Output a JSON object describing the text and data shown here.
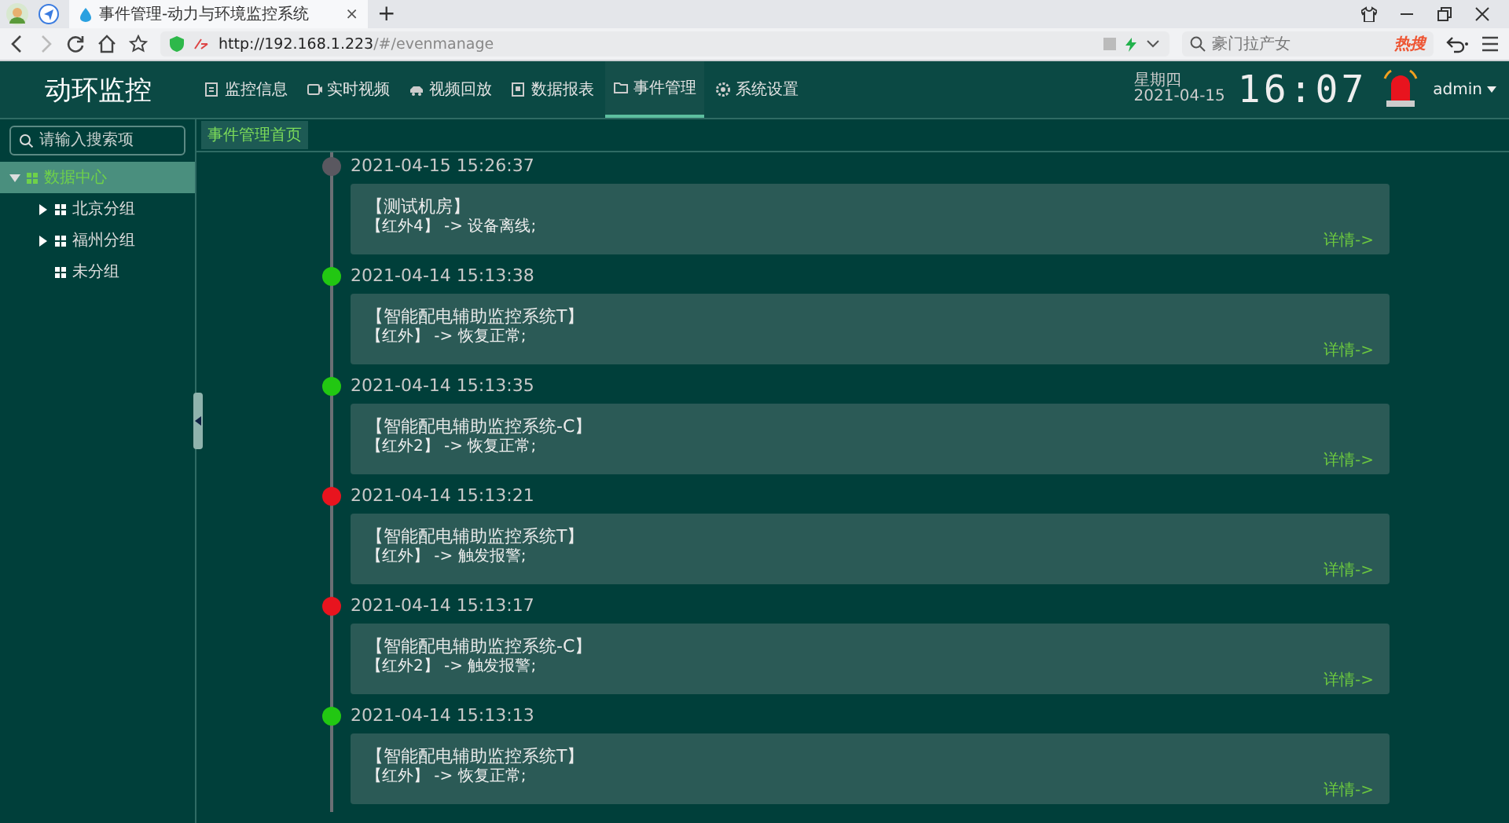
{
  "browser": {
    "tab_title": "事件管理-动力与环境监控系统",
    "tab_close": "×",
    "new_tab": "+",
    "url_host": "http://192.168.1.223",
    "url_path": "/#/evenmanage",
    "search_hint": "豪门拉产女",
    "hot": "热搜"
  },
  "header": {
    "title": "动环监控",
    "nav": [
      {
        "label": "监控信息",
        "selected": false
      },
      {
        "label": "实时视频",
        "selected": false
      },
      {
        "label": "视频回放",
        "selected": false
      },
      {
        "label": "数据报表",
        "selected": false
      },
      {
        "label": "事件管理",
        "selected": true
      },
      {
        "label": "系统设置",
        "selected": false
      }
    ],
    "weekday": "星期四",
    "date": "2021-04-15",
    "time": "16:07",
    "user": "admin"
  },
  "breadcrumb": {
    "label": "事件管理首页",
    "selected": true
  },
  "sidebar": {
    "search": {
      "placeholder": "请输入搜索项"
    },
    "tree": [
      {
        "label": "数据中心",
        "selected": true,
        "expanded": true,
        "children": [
          {
            "label": "北京分组",
            "selected": false,
            "expanded": false
          },
          {
            "label": "福州分组",
            "selected": false,
            "expanded": false
          },
          {
            "label": "未分组",
            "selected": false
          }
        ]
      }
    ]
  },
  "events": [
    {
      "time": "2021-04-15 15:26:37",
      "color": "#5a5860",
      "title": "【测试机房】",
      "detail": "【红外4】 -> 设备离线;",
      "link": "详情->"
    },
    {
      "time": "2021-04-14 15:13:38",
      "color": "#22c712",
      "title": "【智能配电辅助监控系统T】",
      "detail": "【红外】 -> 恢复正常;",
      "link": "详情->"
    },
    {
      "time": "2021-04-14 15:13:35",
      "color": "#22c712",
      "title": "【智能配电辅助监控系统-C】",
      "detail": "【红外2】 -> 恢复正常;",
      "link": "详情->"
    },
    {
      "time": "2021-04-14 15:13:21",
      "color": "#e8141e",
      "title": "【智能配电辅助监控系统T】",
      "detail": "【红外】 -> 触发报警;",
      "link": "详情->"
    },
    {
      "time": "2021-04-14 15:13:17",
      "color": "#e8141e",
      "title": "【智能配电辅助监控系统-C】",
      "detail": "【红外2】 -> 触发报警;",
      "link": "详情->"
    },
    {
      "time": "2021-04-14 15:13:13",
      "color": "#22c712",
      "title": "【智能配电辅助监控系统T】",
      "detail": "【红外】 -> 恢复正常;",
      "link": "详情->"
    }
  ]
}
